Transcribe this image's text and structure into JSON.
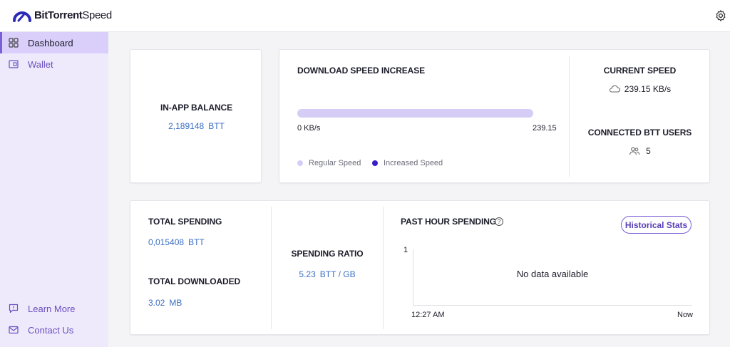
{
  "app": {
    "brand_bold": "BitTorrent",
    "brand_light": "Speed"
  },
  "sidebar": {
    "items": [
      {
        "label": "Dashboard",
        "icon": "grid-icon",
        "active": true
      },
      {
        "label": "Wallet",
        "icon": "wallet-icon",
        "active": false
      }
    ],
    "bottom_items": [
      {
        "label": "Learn More",
        "icon": "chat-icon"
      },
      {
        "label": "Contact Us",
        "icon": "mail-icon"
      }
    ]
  },
  "balance": {
    "title": "IN-APP BALANCE",
    "value": "2,189148",
    "unit": "BTT"
  },
  "download": {
    "title": "DOWNLOAD SPEED INCREASE",
    "min_label": "0 KB/s",
    "max_label": "239.15",
    "legend_regular": "Regular Speed",
    "legend_increased": "Increased Speed",
    "regular_color": "#d6cdf7",
    "increased_color": "#3a1fc9"
  },
  "current_speed": {
    "title": "CURRENT SPEED",
    "value": "239.15 KB/s"
  },
  "connected": {
    "title": "CONNECTED BTT USERS",
    "value": "5"
  },
  "spending": {
    "total_title": "TOTAL SPENDING",
    "total_value": "0,015408",
    "total_unit": "BTT",
    "downloaded_title": "TOTAL DOWNLOADED",
    "downloaded_value": "3.02",
    "downloaded_unit": "MB",
    "ratio_title": "SPENDING RATIO",
    "ratio_value": "5.23",
    "ratio_unit": "BTT / GB"
  },
  "past_hour": {
    "title": "PAST HOUR SPENDING",
    "help": "?",
    "button": "Historical Stats",
    "no_data": "No data available",
    "y_tick": "1",
    "x_start": "12:27 AM",
    "x_end": "Now"
  }
}
